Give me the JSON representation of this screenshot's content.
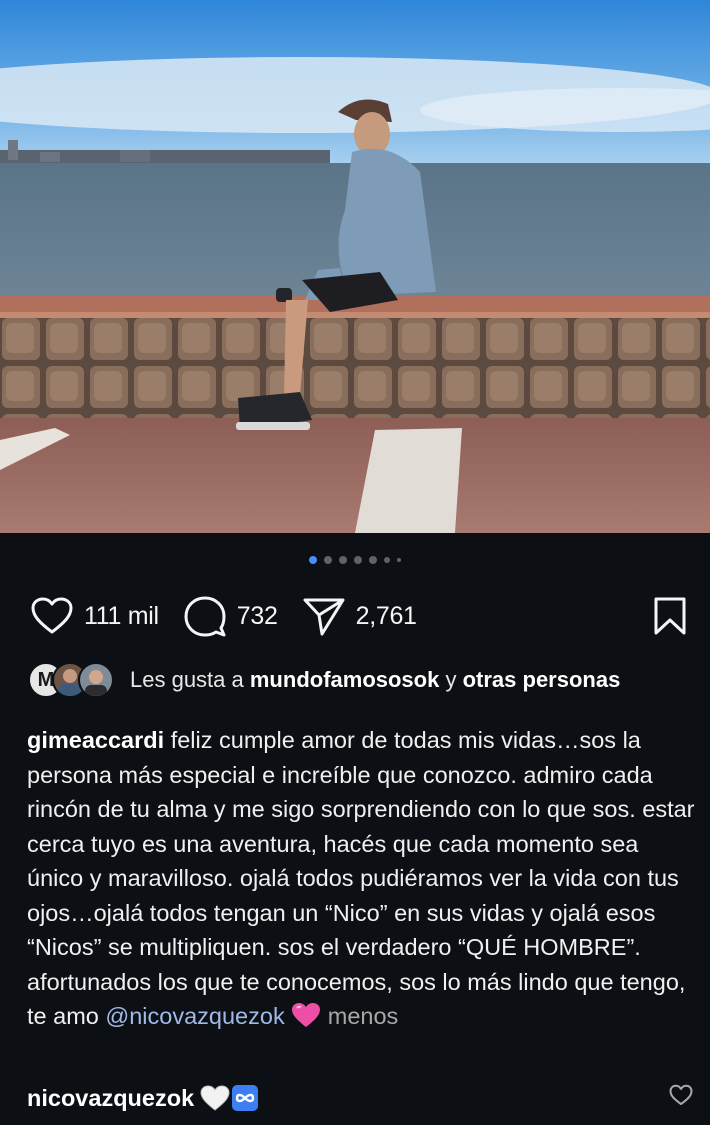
{
  "post": {
    "carousel": {
      "count": 7,
      "active_index": 0
    },
    "actions": {
      "like_count": "111 mil",
      "comment_count": "732",
      "share_count": "2,761"
    },
    "likes": {
      "prefix": "Les gusta a",
      "user": "mundofamososok",
      "conjunction": "y",
      "others": "otras personas",
      "avatar_letter": "M"
    },
    "caption": {
      "username": "gimeaccardi",
      "text": "feliz cumple amor de todas mis vidas…sos la persona más especial e increíble que conozco. admiro cada rincón de tu alma y me sigo sorprendiendo con lo que sos. estar cerca tuyo es una aventura, hacés que cada momento sea único y maravilloso. ojalá todos pudiéramos ver la vida con tus ojos…ojalá todos tengan un “Nico” en sus vidas y ojalá esos “Nicos” se multipliquen. sos el verdadero “QUÉ HOMBRE”. afortunados los que te conocemos, sos lo más lindo que tengo, te amo",
      "mention": "@nicovazquezok",
      "more_label": "menos"
    },
    "comment": {
      "username": "nicovazquezok"
    },
    "icons": {
      "like": "heart-outline-icon",
      "comment": "comment-bubble-icon",
      "share": "paper-plane-icon",
      "save": "bookmark-icon",
      "caption_emoji": "pink-heart-emoji",
      "comment_emojis": [
        "white-heart-emoji",
        "infinity-emoji"
      ]
    },
    "colors": {
      "background": "#0c1014",
      "active_dot": "#4a8df6",
      "mention": "#a0b9e8",
      "secondary_text": "#a8a8a8"
    }
  }
}
